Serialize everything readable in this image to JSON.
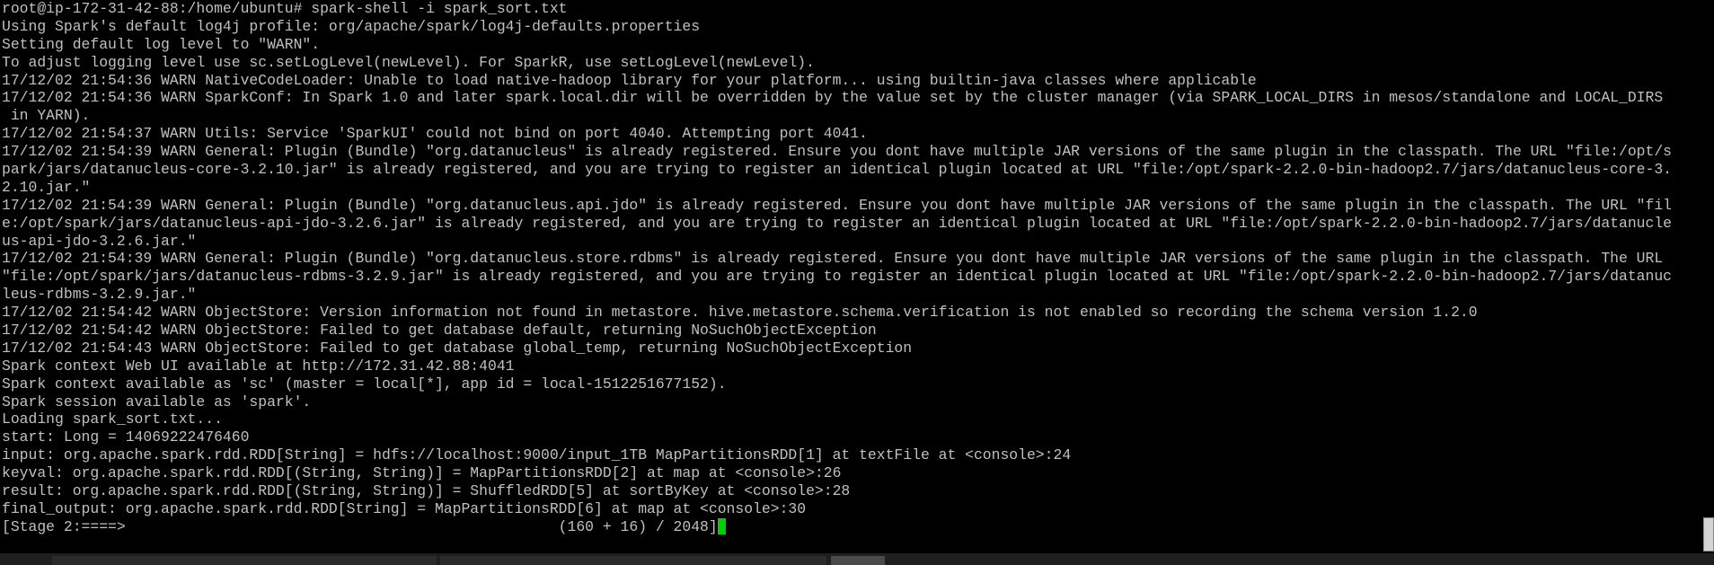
{
  "terminal": {
    "lines": [
      "root@ip-172-31-42-88:/home/ubuntu# spark-shell -i spark_sort.txt",
      "Using Spark's default log4j profile: org/apache/spark/log4j-defaults.properties",
      "Setting default log level to \"WARN\".",
      "To adjust logging level use sc.setLogLevel(newLevel). For SparkR, use setLogLevel(newLevel).",
      "17/12/02 21:54:36 WARN NativeCodeLoader: Unable to load native-hadoop library for your platform... using builtin-java classes where applicable",
      "17/12/02 21:54:36 WARN SparkConf: In Spark 1.0 and later spark.local.dir will be overridden by the value set by the cluster manager (via SPARK_LOCAL_DIRS in mesos/standalone and LOCAL_DIRS",
      " in YARN).",
      "17/12/02 21:54:37 WARN Utils: Service 'SparkUI' could not bind on port 4040. Attempting port 4041.",
      "17/12/02 21:54:39 WARN General: Plugin (Bundle) \"org.datanucleus\" is already registered. Ensure you dont have multiple JAR versions of the same plugin in the classpath. The URL \"file:/opt/s",
      "park/jars/datanucleus-core-3.2.10.jar\" is already registered, and you are trying to register an identical plugin located at URL \"file:/opt/spark-2.2.0-bin-hadoop2.7/jars/datanucleus-core-3.",
      "2.10.jar.\"",
      "17/12/02 21:54:39 WARN General: Plugin (Bundle) \"org.datanucleus.api.jdo\" is already registered. Ensure you dont have multiple JAR versions of the same plugin in the classpath. The URL \"fil",
      "e:/opt/spark/jars/datanucleus-api-jdo-3.2.6.jar\" is already registered, and you are trying to register an identical plugin located at URL \"file:/opt/spark-2.2.0-bin-hadoop2.7/jars/datanucle",
      "us-api-jdo-3.2.6.jar.\"",
      "17/12/02 21:54:39 WARN General: Plugin (Bundle) \"org.datanucleus.store.rdbms\" is already registered. Ensure you dont have multiple JAR versions of the same plugin in the classpath. The URL",
      "\"file:/opt/spark/jars/datanucleus-rdbms-3.2.9.jar\" is already registered, and you are trying to register an identical plugin located at URL \"file:/opt/spark-2.2.0-bin-hadoop2.7/jars/datanuc",
      "leus-rdbms-3.2.9.jar.\"",
      "17/12/02 21:54:42 WARN ObjectStore: Version information not found in metastore. hive.metastore.schema.verification is not enabled so recording the schema version 1.2.0",
      "17/12/02 21:54:42 WARN ObjectStore: Failed to get database default, returning NoSuchObjectException",
      "17/12/02 21:54:43 WARN ObjectStore: Failed to get database global_temp, returning NoSuchObjectException",
      "Spark context Web UI available at http://172.31.42.88:4041",
      "Spark context available as 'sc' (master = local[*], app id = local-1512251677152).",
      "Spark session available as 'spark'.",
      "Loading spark_sort.txt...",
      "start: Long = 14069222476460",
      "input: org.apache.spark.rdd.RDD[String] = hdfs://localhost:9000/input_1TB MapPartitionsRDD[1] at textFile at <console>:24",
      "keyval: org.apache.spark.rdd.RDD[(String, String)] = MapPartitionsRDD[2] at map at <console>:26",
      "result: org.apache.spark.rdd.RDD[(String, String)] = ShuffledRDD[5] at sortByKey at <console>:28",
      "final_output: org.apache.spark.rdd.RDD[String] = MapPartitionsRDD[6] at map at <console>:30",
      "[Stage 2:====>                                                 (160 + 16) / 2048]"
    ]
  },
  "colors": {
    "background": "#000000",
    "foreground": "#c0c0c0",
    "cursor": "#00d000"
  },
  "icons": {
    "cursor": "block-cursor-icon"
  }
}
